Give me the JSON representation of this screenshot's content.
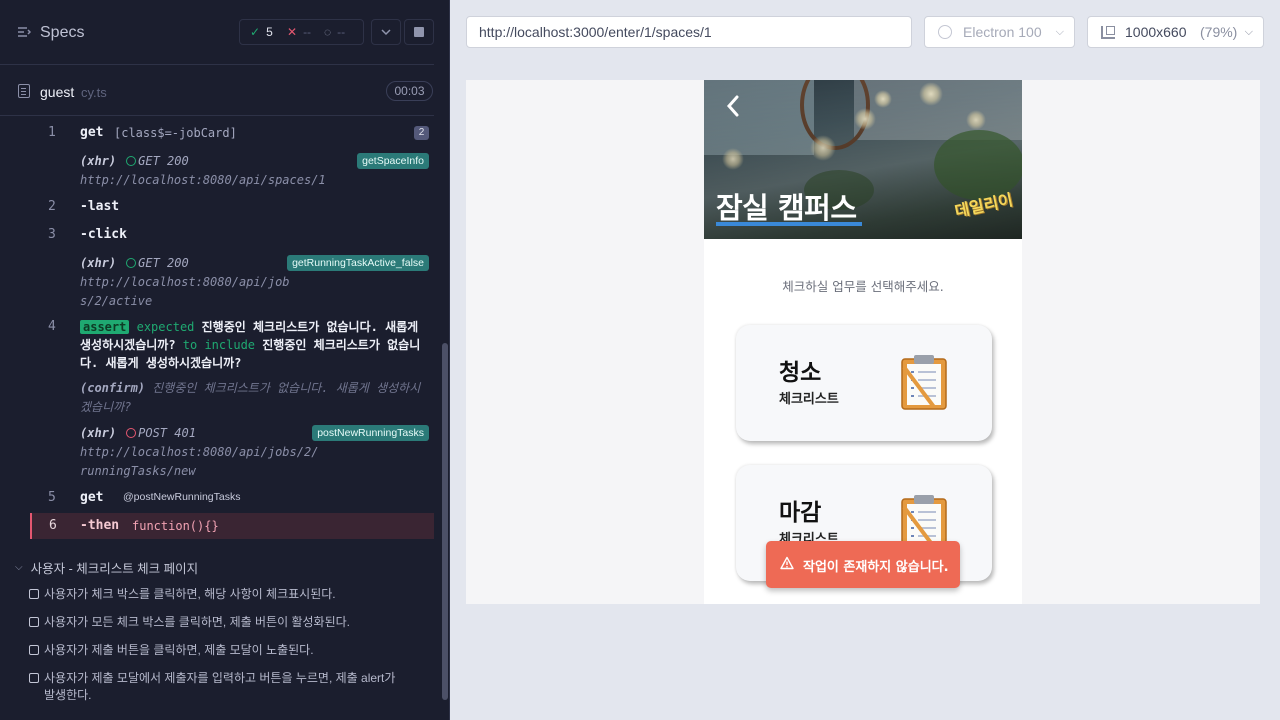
{
  "reporter": {
    "title": "Specs",
    "stats": {
      "passed": "5",
      "failed": "--",
      "pending": "--"
    },
    "file": {
      "name": "guest",
      "ext": "cy.ts",
      "duration": "00:03"
    },
    "commands": [
      {
        "num": "1",
        "name": "get",
        "message": "[class$=-jobCard]",
        "count": "2"
      },
      {
        "xhr_label": "(xhr)",
        "method_status": "GET 200",
        "url": "http://localhost:8080/api/spaces/1",
        "alias": "getSpaceInfo"
      },
      {
        "num": "2",
        "name": "-last"
      },
      {
        "num": "3",
        "name": "-click"
      },
      {
        "xhr_label": "(xhr)",
        "method_status": "GET 200",
        "url": "http://localhost:8080/api/jobs/2/active",
        "alias": "getRunningTaskActive_false"
      },
      {
        "num": "4",
        "tag": "assert",
        "expected_kw": "expected",
        "expected": "진행중인 체크리스트가 없습니다. 새롭게 생성하시겠습니까?",
        "include_kw": "to include",
        "include": "진행중인 체크리스트가 없습니다. 새롭게 생성하시겠습니까?"
      },
      {
        "confirm_label": "(confirm)",
        "confirm_text": "진행중인 체크리스트가 없습니다. 새롭게 생성하시겠습니까?"
      },
      {
        "xhr_label": "(xhr)",
        "method_status": "POST 401",
        "url": "http://localhost:8080/api/jobs/2/runningTasks/new",
        "alias": "postNewRunningTasks"
      },
      {
        "num": "5",
        "name": "get",
        "message": "@postNewRunningTasks"
      },
      {
        "num": "6",
        "name": "-then",
        "message": "function(){}"
      }
    ],
    "suite": {
      "title": "사용자 - 체크리스트 체크 페이지",
      "tests": [
        "사용자가 체크 박스를 클릭하면, 해당 사항이 체크표시된다.",
        "사용자가 모든 체크 박스를 클릭하면, 제출 버튼이 활성화된다.",
        "사용자가 제출 버튼을 클릭하면, 제출 모달이 노출된다.",
        "사용자가 제출 모달에서 제출자를 입력하고 버튼을 누르면, 제출 alert가 발생한다."
      ]
    }
  },
  "toolbar": {
    "url": "http://localhost:3000/enter/1/spaces/1",
    "browser": "Electron 100",
    "viewport": "1000x660",
    "scale": "(79%)"
  },
  "app": {
    "space_title": "잠실 캠퍼스",
    "sign_text": "데일리이",
    "instruction": "체크하실 업무를 선택해주세요.",
    "jobs": [
      {
        "title": "청소",
        "subtitle": "체크리스트"
      },
      {
        "title": "마감",
        "subtitle": "체크리스트"
      }
    ],
    "toast": "작업이 존재하지 않습니다."
  },
  "colors": {
    "reporter_bg": "#1b1e2e",
    "pass": "#1fa971",
    "fail": "#e45770",
    "alias_bg": "#2b7a78",
    "toast_bg": "#ee6a55",
    "accent_underline": "#3a89d8"
  },
  "icons": [
    "menu-icon",
    "check-icon",
    "x-icon",
    "spinner-icon",
    "chevron-down-icon",
    "stop-icon",
    "file-icon",
    "electron-icon",
    "viewport-icon",
    "back-arrow-icon",
    "clipboard-icon",
    "warning-icon"
  ]
}
